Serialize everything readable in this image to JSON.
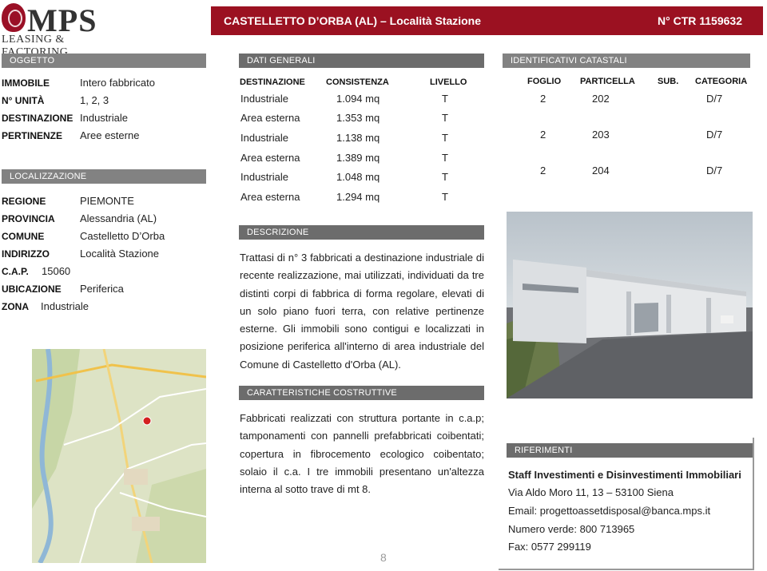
{
  "header": {
    "logo_text": "MPS",
    "logo_sub": "LEASING & FACTORING",
    "title": "CASTELLETTO D’ORBA (AL) – Località Stazione",
    "ctr": "N° CTR 1159632"
  },
  "oggetto": {
    "heading": "OGGETTO",
    "rows": [
      {
        "label": "IMMOBILE",
        "value": "Intero fabbricato"
      },
      {
        "label": "N° UNITÀ",
        "value": "1, 2, 3"
      },
      {
        "label": "DESTINAZIONE",
        "value": "Industriale"
      },
      {
        "label": "PERTINENZE",
        "value": "Aree esterne"
      }
    ]
  },
  "localizzazione": {
    "heading": "LOCALIZZAZIONE",
    "rows": [
      {
        "label": "REGIONE",
        "value": "PIEMONTE"
      },
      {
        "label": "PROVINCIA",
        "value": "Alessandria (AL)"
      },
      {
        "label": "COMUNE",
        "value": "Castelletto D’Orba"
      },
      {
        "label": "INDIRIZZO",
        "value": "Località Stazione"
      },
      {
        "label": "C.A.P.",
        "value": "15060"
      },
      {
        "label": "UBICAZIONE",
        "value": "Periferica"
      },
      {
        "label": "ZONA",
        "value": "Industriale"
      }
    ]
  },
  "dati_generali": {
    "heading": "DATI GENERALI",
    "headers": [
      "DESTINAZIONE",
      "CONSISTENZA",
      "LIVELLO"
    ],
    "rows": [
      [
        "Industriale",
        "1.094 mq",
        "T"
      ],
      [
        "Area esterna",
        "1.353 mq",
        "T"
      ],
      [
        "Industriale",
        "1.138 mq",
        "T"
      ],
      [
        "Area esterna",
        "1.389 mq",
        "T"
      ],
      [
        "Industriale",
        "1.048 mq",
        "T"
      ],
      [
        "Area esterna",
        "1.294 mq",
        "T"
      ]
    ]
  },
  "catastali": {
    "heading": "IDENTIFICATIVI CATASTALI",
    "headers": [
      "FOGLIO",
      "PARTICELLA",
      "SUB.",
      "CATEGORIA"
    ],
    "rows": [
      [
        "2",
        "202",
        "",
        "D/7"
      ],
      [
        "2",
        "203",
        "",
        "D/7"
      ],
      [
        "2",
        "204",
        "",
        "D/7"
      ]
    ]
  },
  "descrizione": {
    "heading": "DESCRIZIONE",
    "text": "Trattasi di n° 3 fabbricati a destinazione industriale di recente realizzazione, mai utilizzati, individuati da tre distinti corpi di fabbrica di forma regolare, elevati di un solo piano fuori terra, con relative pertinenze esterne. Gli immobili sono contigui e localizzati in posizione periferica all'interno di area industriale del Comune di Castelletto d'Orba (AL)."
  },
  "caratteristiche": {
    "heading": "CARATTERISTICHE COSTRUTTIVE",
    "text": "Fabbricati realizzati con struttura portante in c.a.p; tamponamenti con pannelli prefabbricati coibentati; copertura in fibrocemento ecologico coibentato; solaio il c.a. I tre immobili presentano un'altezza interna al sotto trave di mt 8."
  },
  "riferimenti": {
    "heading": "RIFERIMENTI",
    "title": "Staff Investimenti e Disinvestimenti Immobiliari",
    "address": "Via Aldo Moro 11, 13 – 53100 Siena",
    "email": "Email: progettoassetdisposal@banca.mps.it",
    "numero_verde": "Numero verde: 800 713965",
    "fax": "Fax: 0577 299119"
  },
  "page_number": "8",
  "colors": {
    "brand": "#9b1121",
    "section_header": "#828282"
  }
}
